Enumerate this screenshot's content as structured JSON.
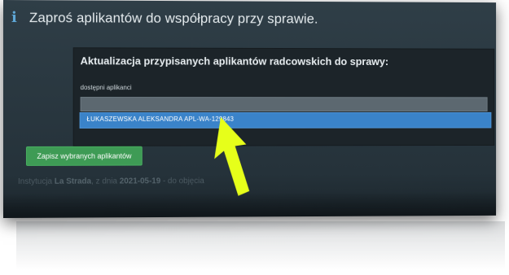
{
  "header": {
    "icon": "info-icon",
    "title": "Zaproś aplikantów do współpracy przy sprawie."
  },
  "form": {
    "title": "Aktualizacja przypisanych aplikantów radcowskich do sprawy:",
    "field_label": "dostępni aplikanci",
    "selected_option": "ŁUKASZEWSKA ALEKSANDRA APL-WA-129843"
  },
  "save_button_label": "Zapisz wybranych aplikantów",
  "footer": {
    "prefix": "Instytucja",
    "institution": "La Strada",
    "date_prefix": ", z dnia",
    "date": "2021-05-19",
    "suffix": "- do objęcia"
  },
  "colors": {
    "arrow": "#e6ff1a",
    "accent": "#3a83c9",
    "button": "#3e9b55"
  }
}
